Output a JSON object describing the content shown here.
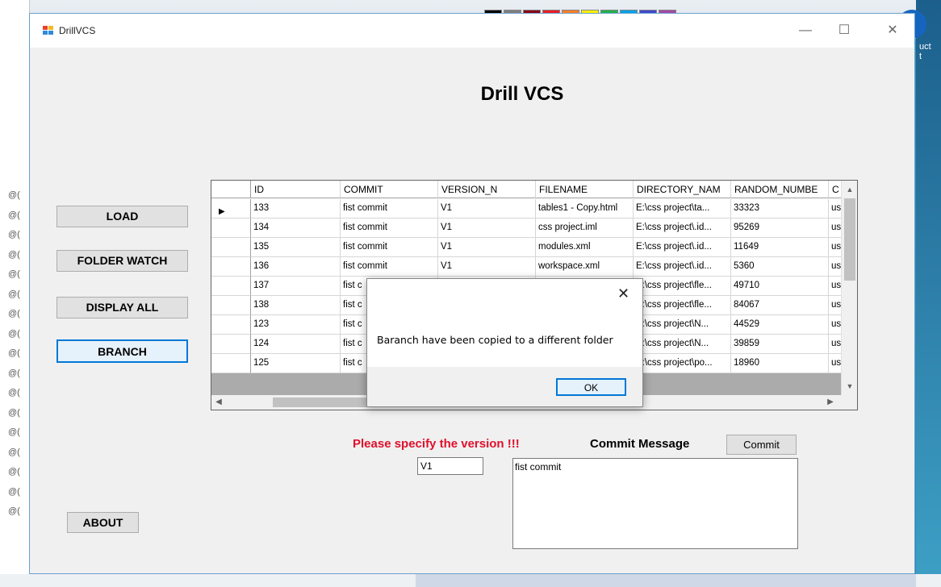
{
  "window": {
    "title": "DrillVCS",
    "controls": {
      "minimize": "—",
      "maximize": "☐",
      "close": "✕"
    }
  },
  "heading": "Drill VCS",
  "sidebar": {
    "load": "LOAD",
    "folder_watch": "FOLDER WATCH",
    "display_all": "DISPLAY ALL",
    "branch": "BRANCH",
    "about": "ABOUT"
  },
  "grid": {
    "columns": [
      "ID",
      "COMMIT",
      "VERSION_N",
      "FILENAME",
      "DIRECTORY_NAM",
      "RANDOM_NUMBE",
      "C"
    ],
    "rows": [
      {
        "id": "133",
        "commit": "fist commit",
        "version": "V1",
        "filename": "tables1 - Copy.html",
        "directory": "E:\\css project\\ta...",
        "random": "33323",
        "extra": "us"
      },
      {
        "id": "134",
        "commit": "fist commit",
        "version": "V1",
        "filename": "css project.iml",
        "directory": "E:\\css project\\.id...",
        "random": "95269",
        "extra": "us"
      },
      {
        "id": "135",
        "commit": "fist commit",
        "version": "V1",
        "filename": "modules.xml",
        "directory": "E:\\css project\\.id...",
        "random": "11649",
        "extra": "us"
      },
      {
        "id": "136",
        "commit": "fist commit",
        "version": "V1",
        "filename": "workspace.xml",
        "directory": "E:\\css project\\.id...",
        "random": "5360",
        "extra": "us"
      },
      {
        "id": "137",
        "commit": "fist c",
        "version": "",
        "filename": "",
        "directory": "E:\\css project\\fle...",
        "random": "49710",
        "extra": "us"
      },
      {
        "id": "138",
        "commit": "fist c",
        "version": "",
        "filename": "",
        "directory": "E:\\css project\\fle...",
        "random": "84067",
        "extra": "us"
      },
      {
        "id": "123",
        "commit": "fist c",
        "version": "",
        "filename": "",
        "directory": "E:\\css project\\N...",
        "random": "44529",
        "extra": "us"
      },
      {
        "id": "124",
        "commit": "fist c",
        "version": "",
        "filename": "",
        "directory": "E:\\css project\\N...",
        "random": "39859",
        "extra": "us"
      },
      {
        "id": "125",
        "commit": "fist c",
        "version": "",
        "filename": "",
        "directory": "E:\\css project\\po...",
        "random": "18960",
        "extra": "us"
      }
    ],
    "selected_row_marker": "▶"
  },
  "dialog": {
    "message": "Baranch have been copied to a different folder",
    "ok": "OK",
    "close": "✕"
  },
  "form": {
    "version_prompt": "Please specify the version !!!",
    "version_value": "V1",
    "commit_message_label": "Commit Message",
    "commit_message_value": "fist commit",
    "commit_button": "Commit"
  },
  "background": {
    "left_rows": [
      "@(",
      "@(",
      "@(",
      "@(",
      "@(",
      "@(",
      "@(",
      "@(",
      "@(",
      "@(",
      "@(",
      "@(",
      "@(",
      "@(",
      "@(",
      "@(",
      "@("
    ],
    "side_text": "uct\nt",
    "palette_colors": [
      "#000000",
      "#7f7f7f",
      "#880015",
      "#ed1c24",
      "#ff7f27",
      "#fff200",
      "#22b14c",
      "#00a2e8",
      "#3f48cc",
      "#a349a4"
    ]
  }
}
